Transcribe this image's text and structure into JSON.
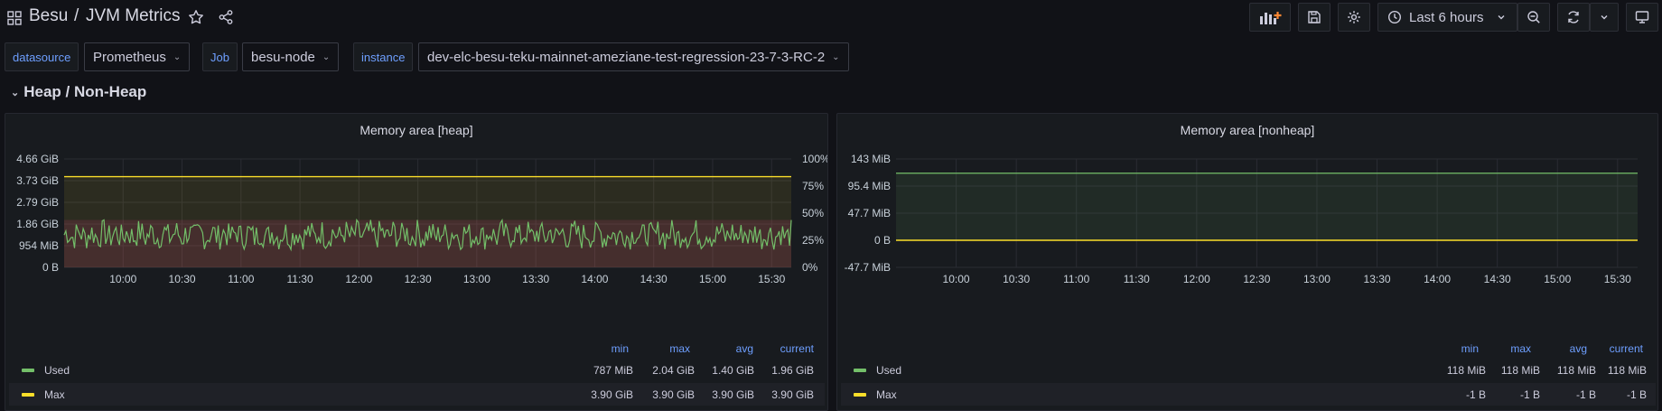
{
  "header": {
    "app": "Besu",
    "separator": "/",
    "title": "JVM Metrics",
    "time_range": "Last 6 hours"
  },
  "variables": [
    {
      "label": "datasource",
      "value": "Prometheus"
    },
    {
      "label": "Job",
      "value": "besu-node"
    },
    {
      "label": "instance",
      "value": "dev-elc-besu-teku-mainnet-ameziane-test-regression-23-7-3-RC-2"
    }
  ],
  "row": {
    "title": "Heap / Non-Heap"
  },
  "panels": [
    {
      "title": "Memory area [heap]",
      "y_ticks": [
        "4.66 GiB",
        "3.73 GiB",
        "2.79 GiB",
        "1.86 GiB",
        "954 MiB",
        "0 B"
      ],
      "y2_ticks": [
        "100%",
        "75%",
        "50%",
        "25%",
        "0%"
      ],
      "x_ticks": [
        "10:00",
        "10:30",
        "11:00",
        "11:30",
        "12:00",
        "12:30",
        "13:00",
        "13:30",
        "14:00",
        "14:30",
        "15:00",
        "15:30"
      ],
      "legend_headers": [
        "min",
        "max",
        "avg",
        "current"
      ],
      "legend": [
        {
          "name": "Used",
          "color": "#73bf69",
          "min": "787 MiB",
          "max": "2.04 GiB",
          "avg": "1.40 GiB",
          "current": "1.96 GiB"
        },
        {
          "name": "Max",
          "color": "#fade2a",
          "min": "3.90 GiB",
          "max": "3.90 GiB",
          "avg": "3.90 GiB",
          "current": "3.90 GiB"
        }
      ]
    },
    {
      "title": "Memory area [nonheap]",
      "y_ticks": [
        "143 MiB",
        "95.4 MiB",
        "47.7 MiB",
        "0 B",
        "-47.7 MiB"
      ],
      "x_ticks": [
        "10:00",
        "10:30",
        "11:00",
        "11:30",
        "12:00",
        "12:30",
        "13:00",
        "13:30",
        "14:00",
        "14:30",
        "15:00",
        "15:30"
      ],
      "legend_headers": [
        "min",
        "max",
        "avg",
        "current"
      ],
      "legend": [
        {
          "name": "Used",
          "color": "#73bf69",
          "min": "118 MiB",
          "max": "118 MiB",
          "avg": "118 MiB",
          "current": "118 MiB"
        },
        {
          "name": "Max",
          "color": "#fade2a",
          "min": "-1 B",
          "max": "-1 B",
          "avg": "-1 B",
          "current": "-1 B"
        }
      ]
    }
  ],
  "chart_data": [
    {
      "type": "area",
      "title": "Memory area [heap]",
      "y_unit": "GiB",
      "ylim": [
        0,
        4.66
      ],
      "y2lim_percent": [
        0,
        100
      ],
      "x_range": [
        "09:30",
        "15:40"
      ],
      "series": [
        {
          "name": "Used",
          "approx_range": [
            0.77,
            2.04
          ],
          "avg": 1.4
        },
        {
          "name": "Max",
          "values_constant": 3.9
        }
      ]
    },
    {
      "type": "area",
      "title": "Memory area [nonheap]",
      "y_unit": "MiB",
      "ylim": [
        -47.7,
        143
      ],
      "x_range": [
        "09:30",
        "15:40"
      ],
      "series": [
        {
          "name": "Used",
          "values_constant": 118
        },
        {
          "name": "Max",
          "values_constant": 0
        }
      ]
    }
  ]
}
